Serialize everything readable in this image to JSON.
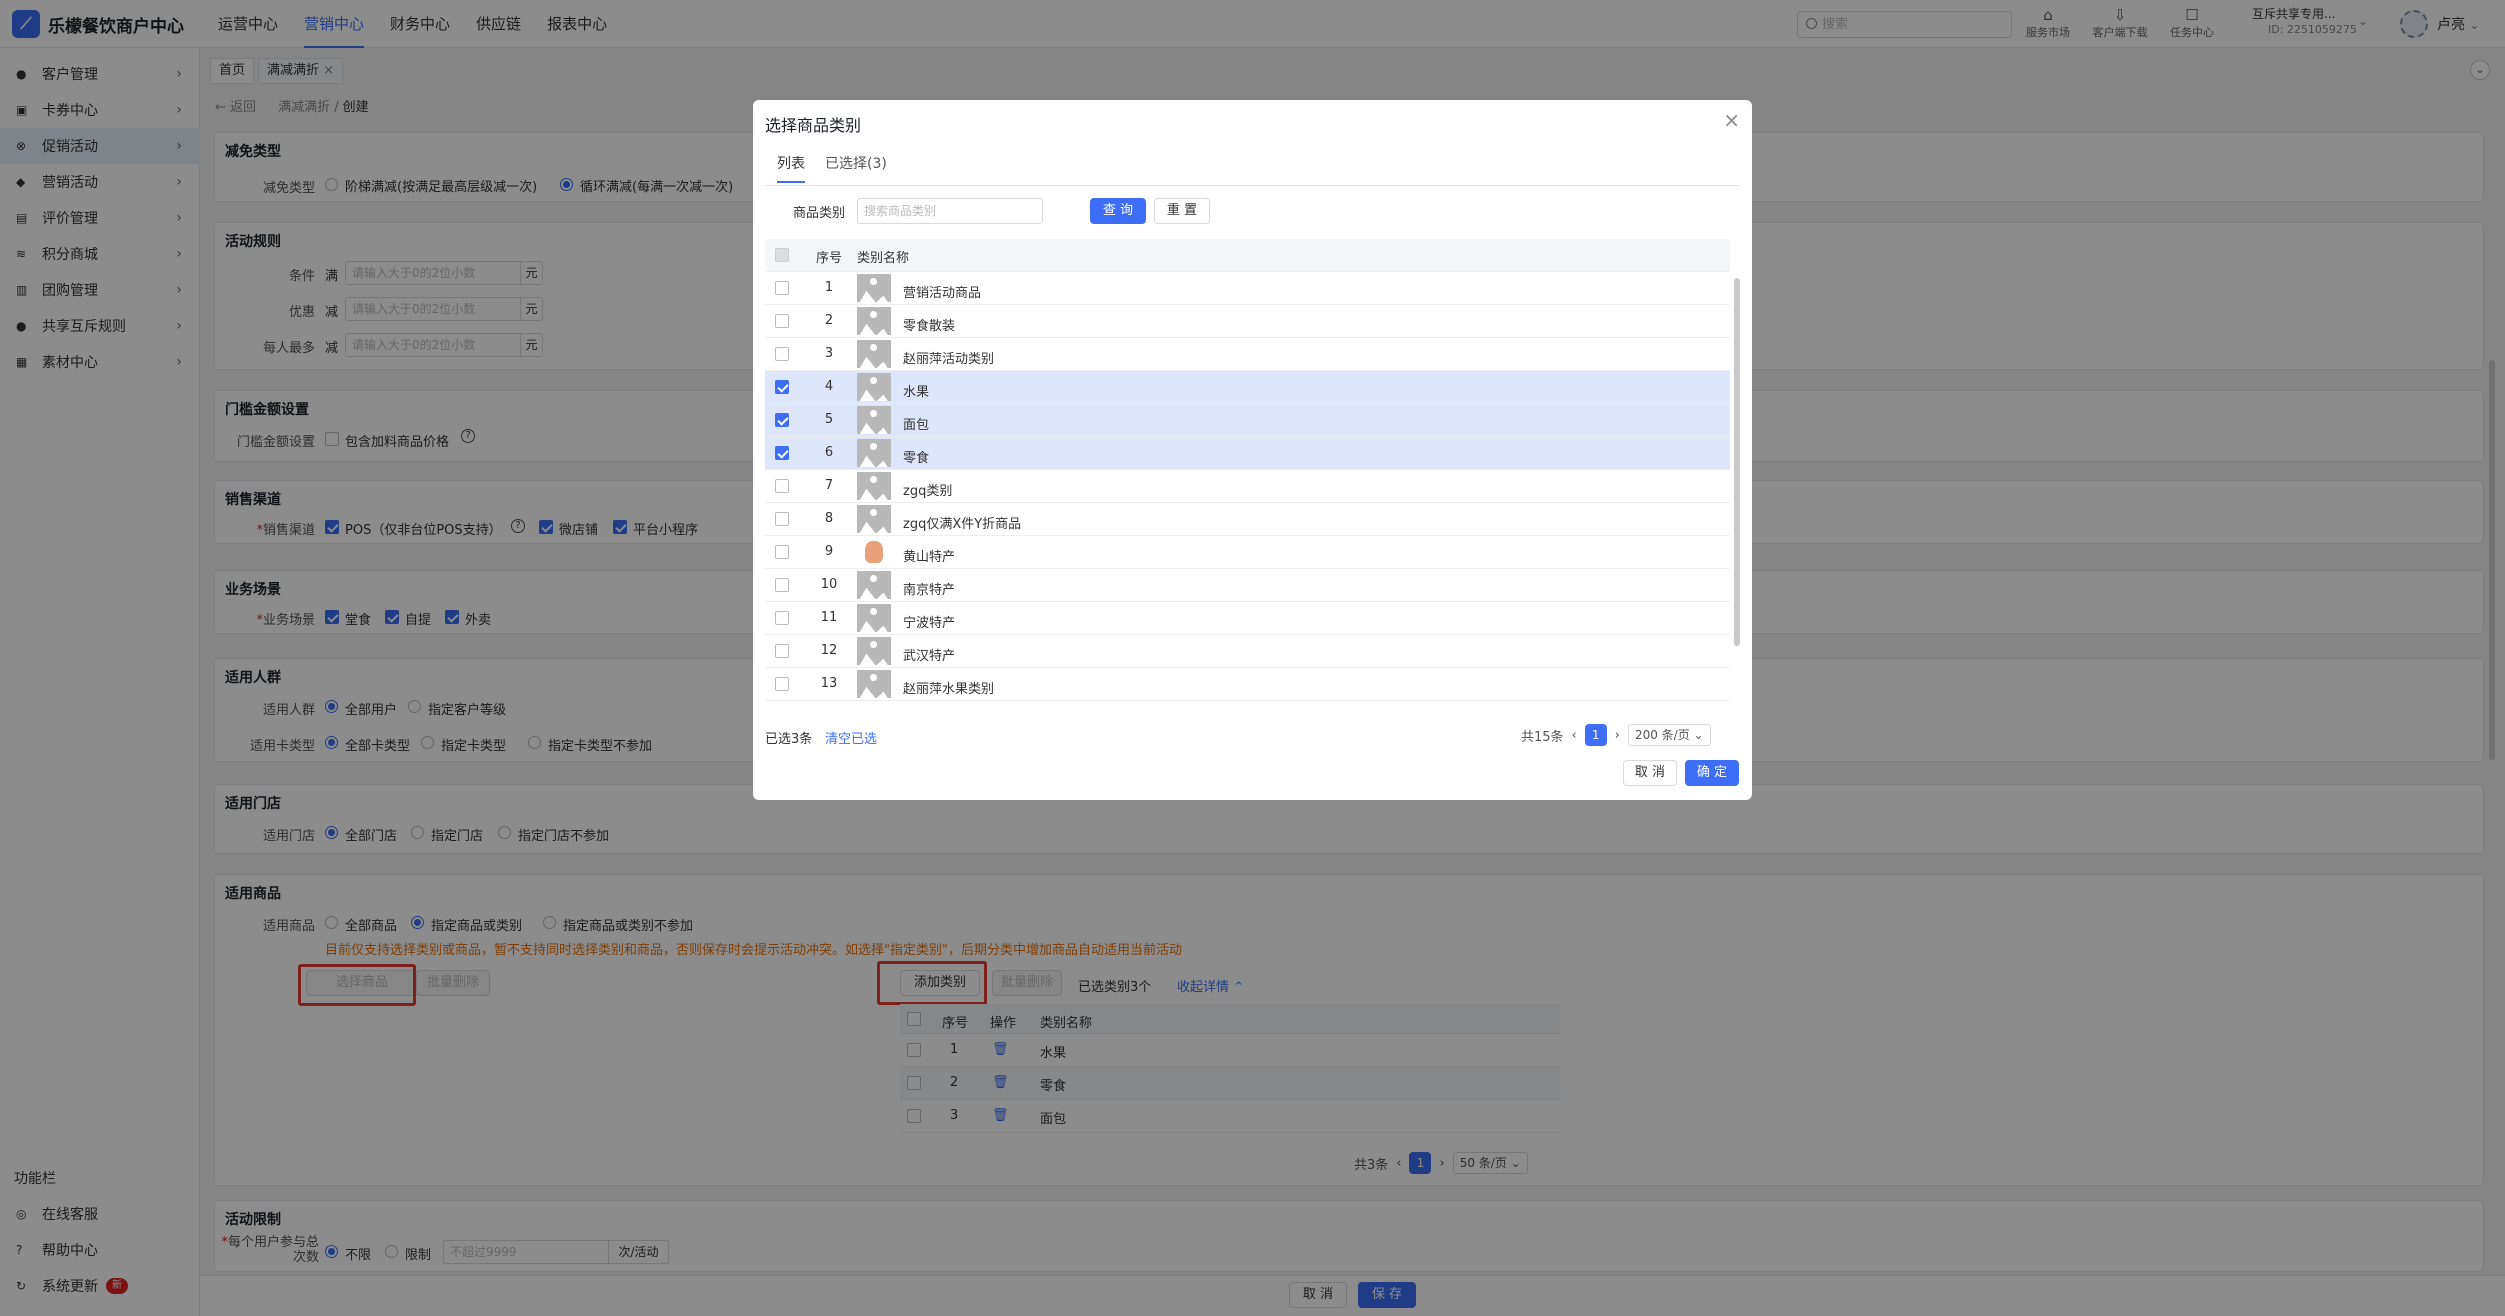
{
  "app": {
    "title": "乐檬餐饮商户中心",
    "logo_glyph": "⟋"
  },
  "topnav": [
    "运营中心",
    "营销中心",
    "财务中心",
    "供应链",
    "报表中心"
  ],
  "search": {
    "placeholder": "搜索"
  },
  "top_icons": [
    {
      "label": "服务市场",
      "glyph": "⌂"
    },
    {
      "label": "客户端下载",
      "glyph": "⇩"
    },
    {
      "label": "任务中心",
      "glyph": "☐"
    }
  ],
  "account": {
    "name": "互斥共享专用...",
    "id": "ID: 2251059275",
    "user": "卢亮"
  },
  "sidebar": {
    "items": [
      {
        "label": "客户管理",
        "glyph": "●"
      },
      {
        "label": "卡券中心",
        "glyph": "▣"
      },
      {
        "label": "促销活动",
        "glyph": "⊗"
      },
      {
        "label": "营销活动",
        "glyph": "◆"
      },
      {
        "label": "评价管理",
        "glyph": "▤"
      },
      {
        "label": "积分商城",
        "glyph": "≋"
      },
      {
        "label": "团购管理",
        "glyph": "▥"
      },
      {
        "label": "共享互斥规则",
        "glyph": "●"
      },
      {
        "label": "素材中心",
        "glyph": "▦"
      }
    ],
    "func_label": "功能栏",
    "func_items": [
      {
        "label": "在线客服",
        "glyph": "◎"
      },
      {
        "label": "帮助中心",
        "glyph": "?"
      },
      {
        "label": "系统更新",
        "glyph": "↻"
      }
    ],
    "new_badge": "新"
  },
  "tabs": [
    "首页",
    "满减满折"
  ],
  "tab_close": "×",
  "breadcrumb": {
    "back": "← 返回",
    "parent": "满减满折",
    "sep": "/",
    "current": "创建"
  },
  "sections": {
    "discount_type": {
      "title": "减免类型",
      "label": "减免类型",
      "opt1": "阶梯满减(按满足最高层级减一次)",
      "opt2": "循环满减(每满一次减一次)"
    },
    "rules": {
      "title": "活动规则",
      "cond_label": "条件",
      "cond_prefix": "满",
      "disc_label": "优惠",
      "disc_prefix": "减",
      "max_label": "每人最多",
      "max_prefix": "减",
      "placeholder": "请输入大于0的2位小数",
      "unit": "元"
    },
    "threshold": {
      "title": "门槛金额设置",
      "label": "门槛金额设置",
      "opt": "包含加料商品价格",
      "help": "?"
    },
    "channel": {
      "title": "销售渠道",
      "label": "销售渠道",
      "opt1": "POS（仅非台位POS支持）",
      "opt2": "微店铺",
      "opt3": "平台小程序"
    },
    "scene": {
      "title": "业务场景",
      "label": "业务场景",
      "opt1": "堂食",
      "opt2": "自提",
      "opt3": "外卖"
    },
    "crowd": {
      "title": "适用人群",
      "label1": "适用人群",
      "c1": "全部用户",
      "c2": "指定客户等级",
      "label2": "适用卡类型",
      "k1": "全部卡类型",
      "k2": "指定卡类型",
      "k3": "指定卡类型不参加"
    },
    "store": {
      "title": "适用门店",
      "label": "适用门店",
      "s1": "全部门店",
      "s2": "指定门店",
      "s3": "指定门店不参加"
    },
    "goods": {
      "title": "适用商品",
      "label": "适用商品",
      "g1": "全部商品",
      "g2": "指定商品或类别",
      "g3": "指定商品或类别不参加",
      "warning": "目前仅支持选择类别或商品，暂不支持同时选择类别和商品，否则保存时会提示活动冲突。如选择\"指定类别\"，后期分类中增加商品自动适用当前活动",
      "select_goods": "选择商品",
      "batch_delete": "批量删除",
      "add_category": "添加类别",
      "batch_delete2": "批量删除",
      "selected_count": "已选类别3个",
      "collapse": "收起详情 ⌃",
      "headers": [
        "序号",
        "操作",
        "类别名称"
      ],
      "rows": [
        {
          "no": "1",
          "name": "水果"
        },
        {
          "no": "2",
          "name": "零食"
        },
        {
          "no": "3",
          "name": "面包"
        }
      ],
      "trash_glyph": "🗑",
      "pager": {
        "total": "共3条",
        "prev": "‹",
        "page": "1",
        "next": "›",
        "size": "50 条/页 ⌄"
      }
    },
    "limit": {
      "title": "活动限制",
      "label": "每个用户参与总次数",
      "o1": "不限",
      "o2": "限制",
      "placeholder": "不超过9999",
      "unit": "次/活动"
    }
  },
  "footer": {
    "cancel": "取 消",
    "save": "保 存"
  },
  "modal": {
    "title": "选择商品类别",
    "close": "×",
    "tabs": [
      "列表",
      "已选择(3)"
    ],
    "filter_label": "商品类别",
    "filter_placeholder": "搜索商品类别",
    "query": "查 询",
    "reset": "重 置",
    "headers": [
      "序号",
      "类别名称"
    ],
    "rows": [
      {
        "no": "1",
        "name": "营销活动商品",
        "checked": false,
        "img": "placeholder"
      },
      {
        "no": "2",
        "name": "零食散装",
        "checked": false,
        "img": "placeholder"
      },
      {
        "no": "3",
        "name": "赵丽萍活动类别",
        "checked": false,
        "img": "placeholder"
      },
      {
        "no": "4",
        "name": "水果",
        "checked": true,
        "img": "placeholder"
      },
      {
        "no": "5",
        "name": "面包",
        "checked": true,
        "img": "placeholder"
      },
      {
        "no": "6",
        "name": "零食",
        "checked": true,
        "img": "placeholder"
      },
      {
        "no": "7",
        "name": "zgq类别",
        "checked": false,
        "img": "placeholder"
      },
      {
        "no": "8",
        "name": "zgq仅满X件Y折商品",
        "checked": false,
        "img": "placeholder"
      },
      {
        "no": "9",
        "name": "黄山特产",
        "checked": false,
        "img": "photo"
      },
      {
        "no": "10",
        "name": "南京特产",
        "checked": false,
        "img": "placeholder"
      },
      {
        "no": "11",
        "name": "宁波特产",
        "checked": false,
        "img": "placeholder"
      },
      {
        "no": "12",
        "name": "武汉特产",
        "checked": false,
        "img": "placeholder"
      },
      {
        "no": "13",
        "name": "赵丽萍水果类别",
        "checked": false,
        "img": "placeholder"
      }
    ],
    "selected": "已选3条",
    "clear": "清空已选",
    "pager": {
      "total": "共15条",
      "prev": "‹",
      "page": "1",
      "next": "›",
      "size": "200 条/页 ⌄"
    },
    "cancel": "取 消",
    "confirm": "确 定"
  },
  "colors": {
    "primary": "#3d6ef5",
    "warning": "#e8700a",
    "highlight": "#e53935"
  }
}
